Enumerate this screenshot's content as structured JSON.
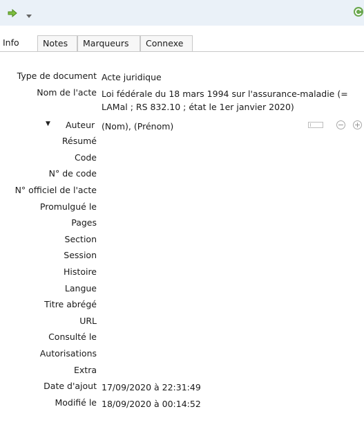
{
  "toolbar": {
    "locate_icon": "green-arrow-icon",
    "dropdown_icon": "chevron-down-icon",
    "sync_icon": "sync-icon",
    "accent_color": "#6aa84f"
  },
  "tabs": [
    {
      "label": "Info",
      "active": true
    },
    {
      "label": "Notes",
      "active": false
    },
    {
      "label": "Marqueurs",
      "active": false
    },
    {
      "label": "Connexe",
      "active": false
    }
  ],
  "fields": {
    "item_type": {
      "label": "Type de document",
      "value": "Acte juridique"
    },
    "name_of_act": {
      "label": "Nom de l'acte",
      "value": "Loi fédérale du 18 mars 1994 sur l'assurance-maladie (= LAMal ; RS 832.10 ; état le 1er janvier 2020)"
    },
    "creator": {
      "label": "Auteur",
      "last": "(Nom),",
      "first": "(Prénom)"
    },
    "abstract": {
      "label": "Résumé",
      "value": ""
    },
    "code": {
      "label": "Code",
      "value": ""
    },
    "code_number": {
      "label": "N° de code",
      "value": ""
    },
    "public_law_number": {
      "label": "N° officiel de l'acte",
      "value": ""
    },
    "date_enacted": {
      "label": "Promulgué le",
      "value": ""
    },
    "pages": {
      "label": "Pages",
      "value": ""
    },
    "section": {
      "label": "Section",
      "value": ""
    },
    "session": {
      "label": "Session",
      "value": ""
    },
    "history": {
      "label": "Histoire",
      "value": ""
    },
    "language": {
      "label": "Langue",
      "value": ""
    },
    "short_title": {
      "label": "Titre abrégé",
      "value": ""
    },
    "url": {
      "label": "URL",
      "value": ""
    },
    "accessed": {
      "label": "Consulté le",
      "value": ""
    },
    "rights": {
      "label": "Autorisations",
      "value": ""
    },
    "extra": {
      "label": "Extra",
      "value": ""
    },
    "date_added": {
      "label": "Date d'ajout",
      "value": "17/09/2020 à 22:31:49"
    },
    "modified": {
      "label": "Modifié le",
      "value": "18/09/2020 à 00:14:52"
    }
  }
}
